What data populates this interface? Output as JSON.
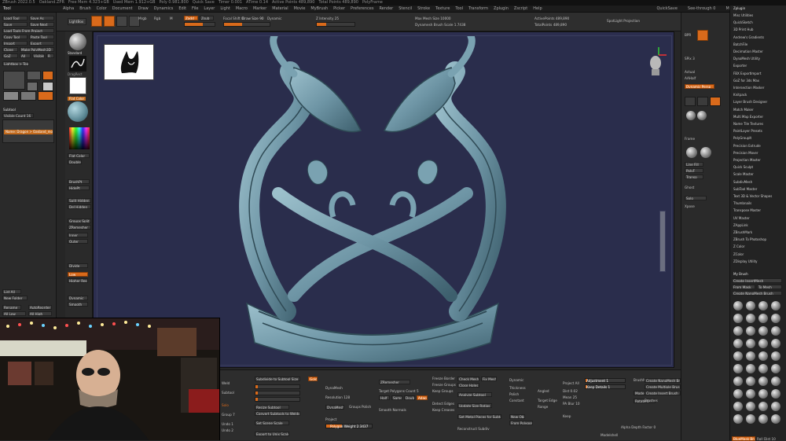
{
  "titlebar": {
    "segments": [
      "ZBrush 2022.0.5",
      "Oakland.ZPR",
      "Free Mem 4.323+GB",
      "Used Mem 1.912+GB",
      "Poly 0.981.800",
      "Quick Save",
      "Timer 0.001",
      "ATime 0.14",
      "Active Points 489,890",
      "Total Points 489,890",
      "PolyFrame"
    ]
  },
  "menubar": {
    "items": [
      "Alpha",
      "Brush",
      "Color",
      "Document",
      "Draw",
      "Dynamics",
      "Edit",
      "File",
      "Layer",
      "Light",
      "Macro",
      "Marker",
      "Material",
      "Movie",
      "MyBrush",
      "Picker",
      "Preferences",
      "Render",
      "Stencil",
      "Stroke",
      "Texture",
      "Tool",
      "Transform",
      "Zplugin",
      "Zscript",
      "Help"
    ],
    "right_items": [
      "QuickSave",
      "See-through 0",
      "Menus",
      "DefaultZScript"
    ],
    "tool_label": "Tool"
  },
  "left_tools": {
    "buttons": [
      "Load Tool",
      "Save As",
      "Save",
      "Save Next",
      "Load Tools From Project",
      "Copy Tool",
      "Paste Tool",
      "Import",
      "Export",
      "Clone",
      "Make PolyMesh3D",
      "GoZ",
      "All",
      "Visible",
      "R",
      "Lightbox > Tools"
    ],
    "subtool_label": "Subtool",
    "subtool_count": "Visible Count 16",
    "subtool_name": "Name: Dragon > Oakland_model",
    "folder_label": "New Folder",
    "list_all": "List All",
    "rename": "Rename",
    "autoreorder": "AutoReorder",
    "all_low": "All Low",
    "all_high": "All High"
  },
  "tool_shelf": {
    "buttons": [
      "LightBox",
      "Edit",
      "Draw",
      "Move",
      "Scale",
      "Rotate"
    ],
    "mrgb": "Mrgb",
    "rgb": "Rgb",
    "m": "M",
    "zadd": "Zadd",
    "zsub": "Zsub",
    "focal_shift": "Focal Shift 0",
    "draw_size": "Draw Size 90",
    "z_intensity": "Z Intensity 25",
    "rgb_intensity": "Rgb Intensity 100",
    "dynamic": "Dynamic",
    "active_points": "ActivePoints 489,890",
    "total_points": "TotalPoints 489,890",
    "max_mesh": "Max Mesh Size 10000",
    "dynamesh_brush": "Dynamesh Brush Scale 1.7438",
    "spot_light": "SpotLight Projection"
  },
  "left_tray": {
    "items": [
      "Standard",
      "DragRect",
      "Flat Color",
      "Double",
      "BrushPt",
      "HidePt",
      "Split Hidden",
      "Del Hidden",
      "Groups Split",
      "ZRemesher",
      "Inner",
      "Outer",
      "Divide",
      "Low",
      "Higher Res",
      "Dynamic",
      "Smooth"
    ],
    "grid_label": "Floor"
  },
  "right_shelf": {
    "items": [
      "BPR",
      "SPix 3",
      "Actual",
      "AAHalf",
      "Dynamic Persp",
      "Floor",
      "Local",
      "L.Sym",
      "Gyz",
      "Frame",
      "Move",
      "Scale",
      "Rotate",
      "Line Fill",
      "PolyF",
      "Transp",
      "Ghost",
      "Solo",
      "Xpose"
    ]
  },
  "right_panel": {
    "header": "Zplugin",
    "items": [
      "Misc Utilities",
      "QuickSketch",
      "3D Print Hub",
      "Andrew's Gradients",
      "BatchFile",
      "Decimation Master",
      "DynaMesh Utility",
      "Exporter",
      "FBX ExportImport",
      "GoZ for 3ds Max",
      "Intersection Masker",
      "Knitpack",
      "Layer Brush Designer",
      "Match Maker",
      "Multi Map Exporter",
      "Name Tile Textures",
      "PaintLayer Presets",
      "PolyGroupIt",
      "Precision Extrude",
      "Precision Mover",
      "Projection Master",
      "Quick Sculpt",
      "Scale Master",
      "SubdivMesh",
      "SubTool Master",
      "Text 3D & Vector Shapes",
      "Thumbnails",
      "Transpose Master",
      "UV Master",
      "ZAppLink",
      "ZBrushMark",
      "ZBrush To Photoshop",
      "Z Color",
      "ZColor",
      "ZDisplay Utility"
    ],
    "mybrush_header": "My Brush",
    "create_insert": "Create InsertMesh",
    "from_mask": "From Mask",
    "to_mesh": "To Mesh",
    "create_nano": "Create NanoMesh Brush",
    "bottom_label": "BlueMask Brush",
    "roll_label": "Roll Dist 10"
  },
  "bottom_panel": {
    "column1": [
      "Weld",
      "Subtool",
      "Solo",
      "Group 7",
      "Undo 1",
      "Undo 2"
    ],
    "subdivide_label": "Subdivide to Subtool Size",
    "split_label": "Split to Similar Parts",
    "rebuild_label": "Resize Subtool",
    "convert_label": "Convert Subtools to Welds",
    "set_label": "Set Scene Scale",
    "export_label": "Export to Unix Scale",
    "dynamesh_label": "DynaMesh",
    "resolution_label": "Resolution 128",
    "groups_label": "Groups",
    "polish_label": "Polish",
    "project_label": "Project",
    "zremesher_label": "ZRemesher",
    "target_poly": "Target Polygons Count 5",
    "half": "Half",
    "same": "Same",
    "double": "Double",
    "adapt": "Adapt",
    "smooth_normals": "Smooth Normals",
    "freeze_label": "Freeze Border",
    "freeze_groups": "Freeze Groups",
    "keep_groups": "Keep Groups",
    "detect_edges": "Detect Edges",
    "keep_creases": "Keep Creases",
    "check_mesh": "Check Mesh Int",
    "fix_mesh": "Fix Mesh",
    "close_holes": "Close Holes",
    "analyze_label": "Analyze Subtool",
    "update_label": "Update Size Ratios",
    "set_metal": "Set Metal Pieces for Subtool",
    "reconstruct": "Reconstruct Subdiv",
    "dynamic_label": "Dynamic",
    "thickness": "Thickness",
    "polish_b": "Polish",
    "constant": "Constant",
    "hm_slider": "Polygon Weight 2.3437",
    "aligned": "Angled",
    "adjustment": "Adjustment 1",
    "keep_details": "Keep Details 1",
    "keep_details_label": "Keep",
    "target_label": "Target Edge",
    "range_label": "Range",
    "projection": "Project All",
    "dist": "Dist 0.02",
    "mean": "Mean 25",
    "prounds": "PA Blur 10",
    "new_object": "New Object",
    "from_polygons": "From Polygons",
    "create_nano_mesh": "Create NanoMesh Brush",
    "create_multi": "Create Multiple Brush",
    "ibrush": "Create Insert Brush",
    "mode_label": "Mode 2",
    "rotate_label": "Rotate 0",
    "brush_label": "BrushMode",
    "gold_btn": "Gold",
    "brushes": "Brushes",
    "alpha_depth": "Alpha Depth Factor 0",
    "modelshell": "Modelshell"
  },
  "webcam": {
    "description": "streamer webcam overlay"
  },
  "colors": {
    "accent": "#d96a1b",
    "viewport_bg": "#2c2e4f",
    "sculpt": "#6e95a5"
  }
}
